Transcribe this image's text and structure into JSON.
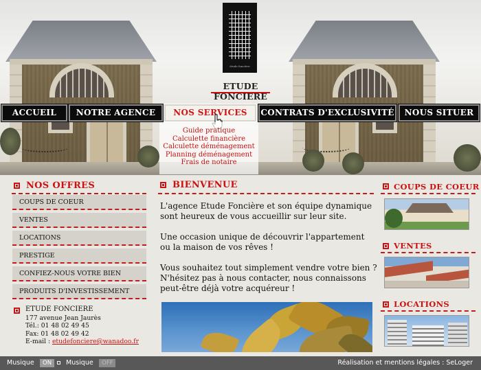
{
  "brand": {
    "name": "ETUDE FONCIERE",
    "logo_caption": "étude foncière"
  },
  "nav": [
    {
      "label": "ACCUEIL"
    },
    {
      "label": "NOTRE AGENCE"
    },
    {
      "label": "NOS SERVICES"
    },
    {
      "label": "CONTRATS D'EXCLUSIVITÉ"
    },
    {
      "label": "NOUS SITUER"
    }
  ],
  "submenu": [
    "Guide pratique",
    "Calculette financière",
    "Calculette déménagement",
    "Planning déménagement",
    "Frais de notaire"
  ],
  "offres": {
    "title": "NOS OFFRES",
    "items": [
      "COUPS DE COEUR",
      "VENTES",
      "LOCATIONS",
      "PRESTIGE",
      "CONFIEZ-NOUS VOTRE BIEN",
      "PRODUITS D'INVESTISSEMENT"
    ]
  },
  "contact": {
    "name": "ETUDE FONCIERE",
    "address": "177 avenue Jean Jaurès",
    "tel": "Tél.: 01 48 02 49 45",
    "fax": "Fax: 01 48 02 49 42",
    "email_label": "E-mail : ",
    "email": "etudefonciere@wanadoo.fr"
  },
  "welcome": {
    "title": "BIENVENUE",
    "p1": "L'agence Etude Foncière et son équipe dynamique sont heureux de vous accueillir sur leur site.",
    "p2": "Une occasion unique de découvrir l'appartement ou la maison de vos rêves !",
    "p3": "Vous souhaitez tout simplement vendre votre bien ? N'hésitez pas à nous contacter, nous connaissons peut-être déjà votre acquéreur !"
  },
  "sidebar": {
    "coups": "COUPS DE COEUR",
    "ventes": "VENTES",
    "locations": "LOCATIONS"
  },
  "footer": {
    "musique1": "Musique",
    "on": "ON",
    "musique2": "Musique",
    "off": "OFF",
    "credits": "Réalisation et mentions légales : SeLoger"
  },
  "colors": {
    "accent": "#cc1111",
    "nav_bg": "#0b0b0b",
    "footer_bg": "#585858"
  }
}
